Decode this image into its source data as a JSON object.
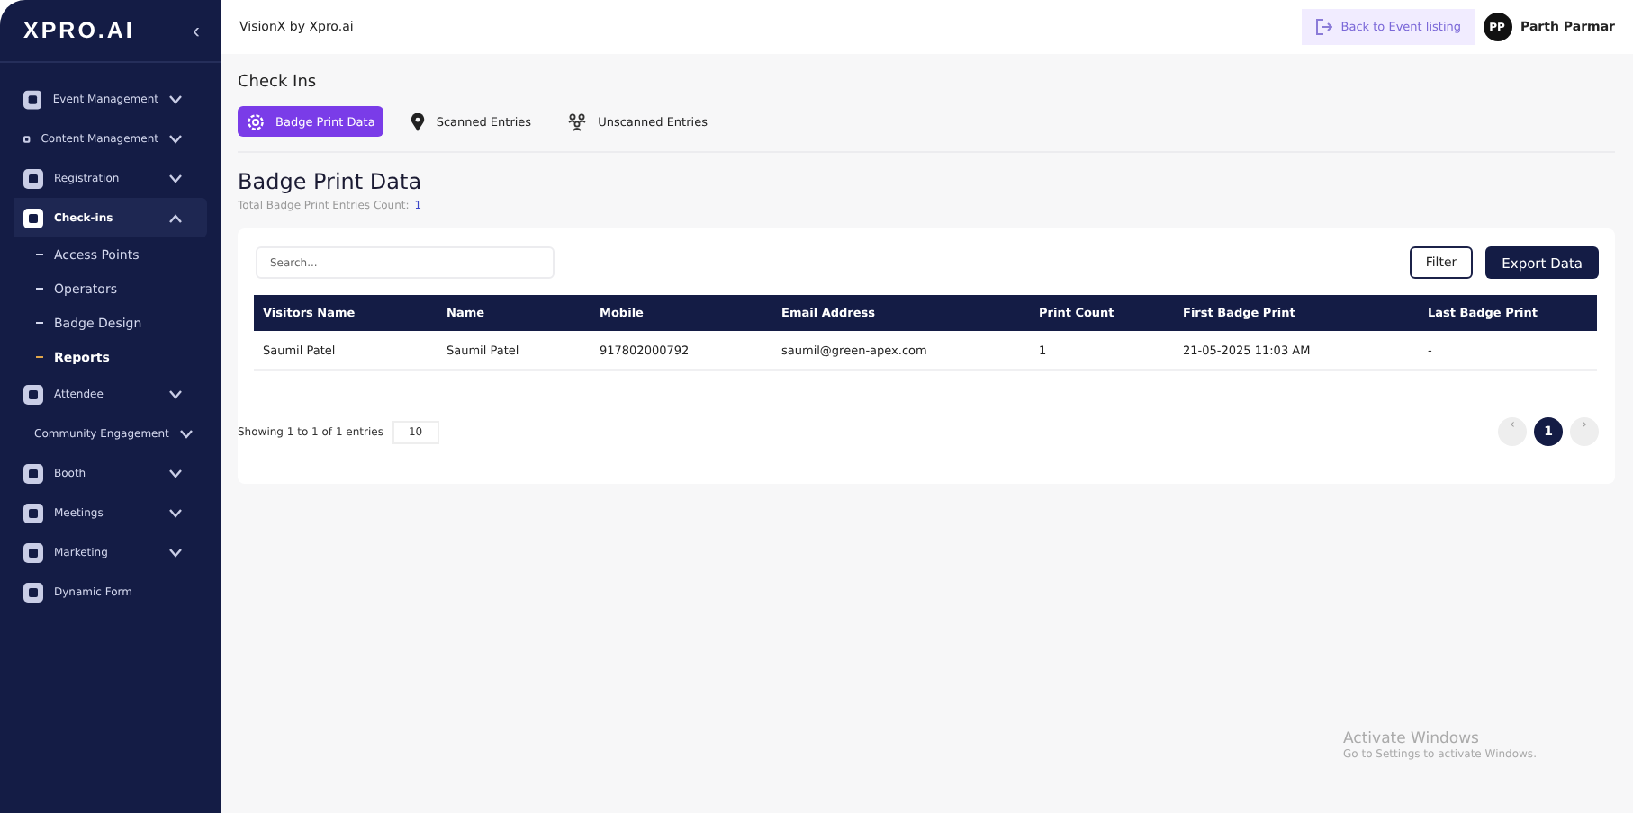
{
  "sidebar": {
    "logo": "XPRO.AI",
    "collapse": "‹",
    "items": [
      {
        "label": "Event Management",
        "expanded": false,
        "selected": false
      },
      {
        "label": "Content Management",
        "expanded": false,
        "selected": false
      },
      {
        "label": "Registration",
        "expanded": false,
        "selected": false
      },
      {
        "label": "Check-ins",
        "expanded": true,
        "selected": true,
        "children": [
          {
            "label": "Access Points",
            "selected": false
          },
          {
            "label": "Operators",
            "selected": false
          },
          {
            "label": "Badge Design",
            "selected": false
          },
          {
            "label": "Reports",
            "selected": true
          }
        ]
      },
      {
        "label": "Attendee",
        "expanded": false,
        "selected": false
      },
      {
        "label": "Community Engagement",
        "expanded": false,
        "selected": false
      },
      {
        "label": "Booth",
        "expanded": false,
        "selected": false
      },
      {
        "label": "Meetings",
        "expanded": false,
        "selected": false
      },
      {
        "label": "Marketing",
        "expanded": false,
        "selected": false
      },
      {
        "label": "Dynamic Form",
        "selected": false
      }
    ]
  },
  "header": {
    "brand": "VisionX by Xpro.ai",
    "back_button": "Back to Event listing",
    "avatar": "PP",
    "user": "Parth Parmar"
  },
  "page_title": "Check Ins",
  "tabs": [
    {
      "label": "Badge Print Data",
      "selected": true
    },
    {
      "label": "Scanned Entries",
      "selected": false
    },
    {
      "label": "Unscanned Entries",
      "selected": false
    }
  ],
  "section": {
    "title": "Badge Print Data",
    "count_label": "Total Badge Print Entries Count:",
    "count": "1"
  },
  "search": {
    "placeholder": "Search..."
  },
  "buttons": {
    "filter": "Filter",
    "export": "Export Data"
  },
  "table": {
    "columns": [
      "Visitors Name",
      "Name",
      "Mobile",
      "Email Address",
      "Print Count",
      "First Badge Print",
      "Last Badge Print"
    ],
    "rows": [
      [
        "Saumil Patel",
        "Saumil Patel",
        "917802000792",
        "saumil@green-apex.com",
        "1",
        "21-05-2025 11:03 AM",
        "-"
      ]
    ]
  },
  "footer": {
    "showing": "Showing 1 to 1 of 1 entries",
    "page_size": "10",
    "prev": "‹",
    "pages": [
      {
        "label": "1",
        "selected": true
      }
    ],
    "next": "›"
  },
  "os_notice": {
    "title": "Activate Windows",
    "text": "Go to Settings to activate Windows."
  }
}
